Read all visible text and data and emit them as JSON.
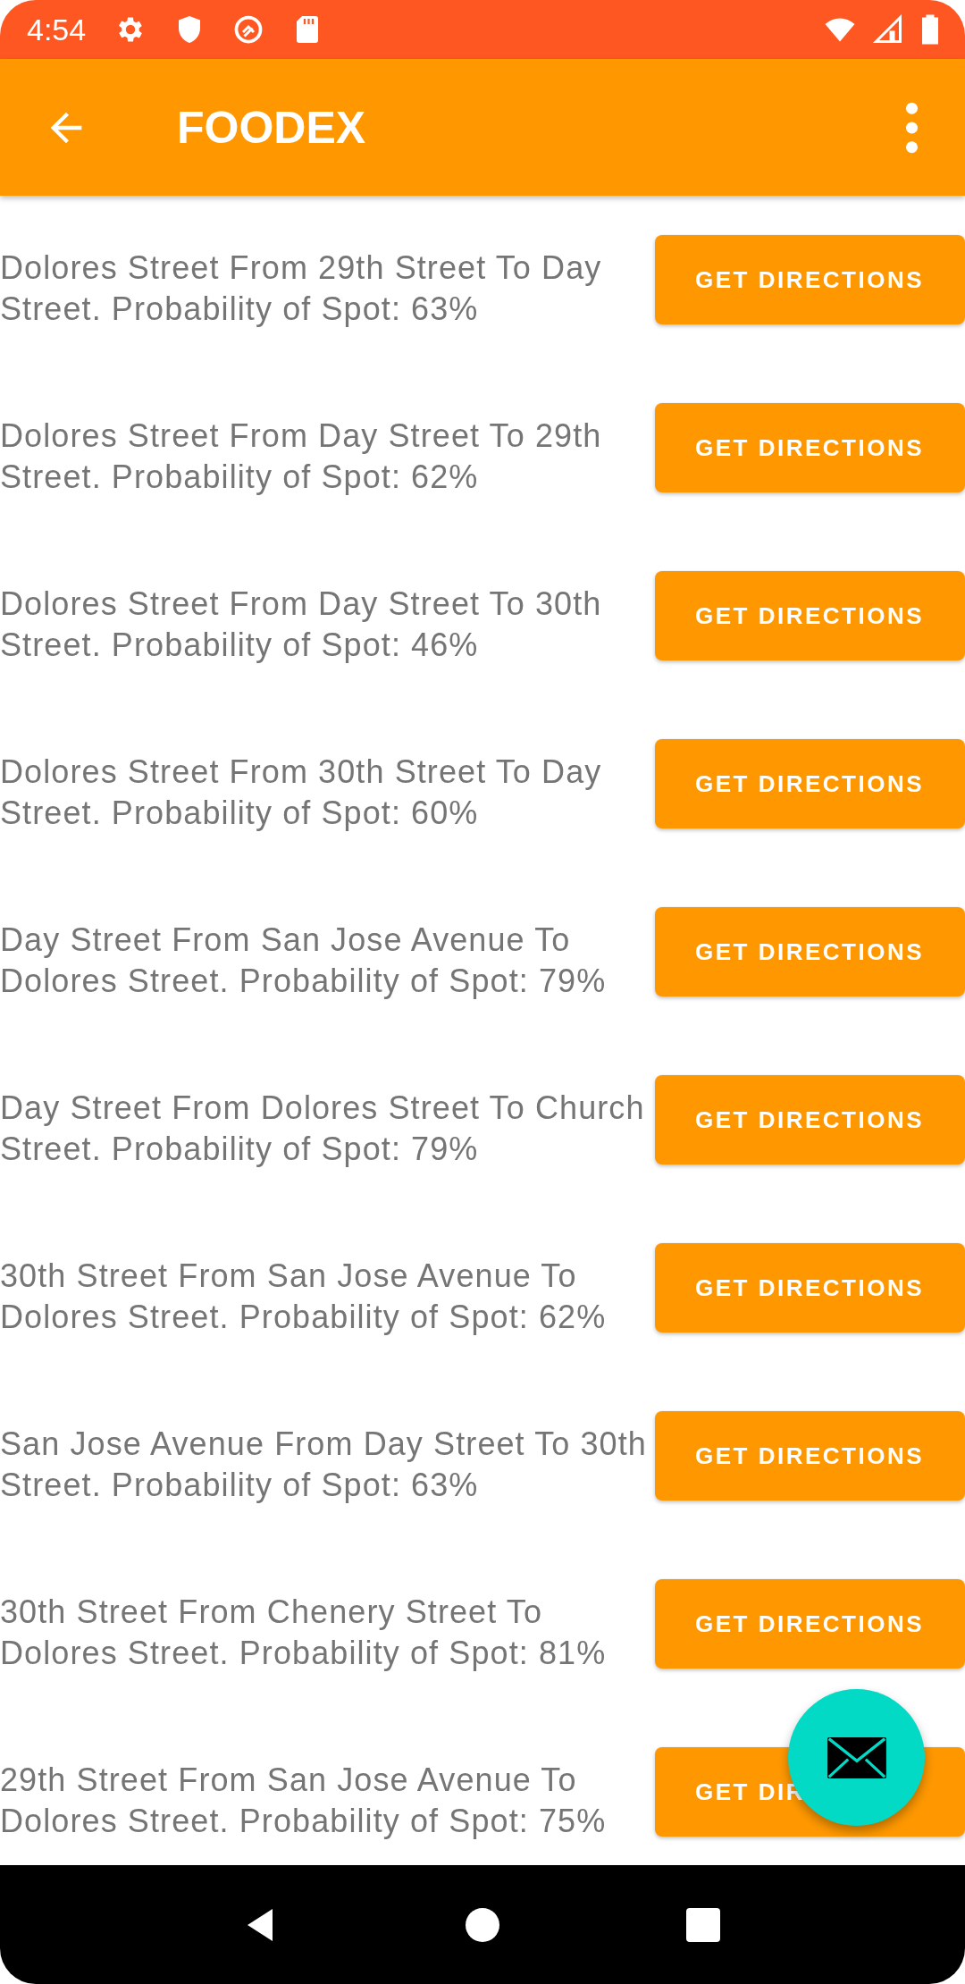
{
  "status_bar": {
    "time": "4:54"
  },
  "app_bar": {
    "title": "FOODEX"
  },
  "spots": [
    {
      "description": "Dolores Street From 29th Street To Day Street. Probability of Spot: 63%",
      "button": "GET DIRECTIONS"
    },
    {
      "description": "Dolores Street From Day Street To 29th Street. Probability of Spot: 62%",
      "button": "GET DIRECTIONS"
    },
    {
      "description": "Dolores Street From Day Street To 30th Street. Probability of Spot: 46%",
      "button": "GET DIRECTIONS"
    },
    {
      "description": "Dolores Street From 30th Street To Day Street. Probability of Spot: 60%",
      "button": "GET DIRECTIONS"
    },
    {
      "description": "Day Street From San Jose Avenue To Dolores Street. Probability of Spot: 79%",
      "button": "GET DIRECTIONS"
    },
    {
      "description": "Day Street From Dolores Street To Church Street. Probability of Spot: 79%",
      "button": "GET DIRECTIONS"
    },
    {
      "description": "30th Street From San Jose Avenue To Dolores Street. Probability of Spot: 62%",
      "button": "GET DIRECTIONS"
    },
    {
      "description": "San Jose Avenue From Day Street To 30th Street. Probability of Spot: 63%",
      "button": "GET DIRECTIONS"
    },
    {
      "description": "30th Street From Chenery Street To Dolores Street. Probability of Spot: 81%",
      "button": "GET DIRECTIONS"
    },
    {
      "description": "29th Street From San Jose Avenue To Dolores Street. Probability of Spot: 75%",
      "button": "GET DIR"
    }
  ]
}
